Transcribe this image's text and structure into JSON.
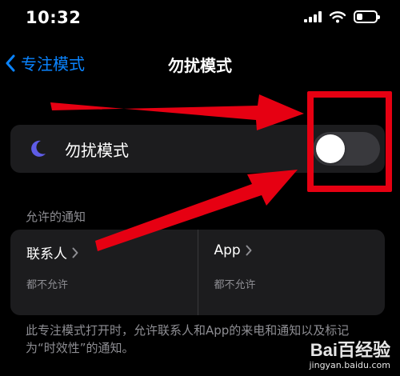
{
  "status_bar": {
    "time": "10:32"
  },
  "nav": {
    "back_label": "专注模式",
    "title": "勿扰模式"
  },
  "toggle": {
    "label": "勿扰模式",
    "state": "off"
  },
  "section": {
    "header": "允许的通知"
  },
  "allow": {
    "people": {
      "title": "联系人",
      "subtitle": "都不允许"
    },
    "apps": {
      "title": "App",
      "subtitle": "都不允许"
    }
  },
  "footer": {
    "text": "此专注模式打开时，允许联系人和App的来电和通知以及标记为“时效性”的通知。"
  },
  "watermark": {
    "logo": "Bai百经验",
    "url": "jingyan.baidu.com"
  },
  "colors": {
    "background": "#000000",
    "card": "#1c1c1e",
    "accent": "#0a84ff",
    "moon": "#5e5ce6",
    "annotation": "#e60012",
    "secondary_text": "#8e8e93"
  }
}
